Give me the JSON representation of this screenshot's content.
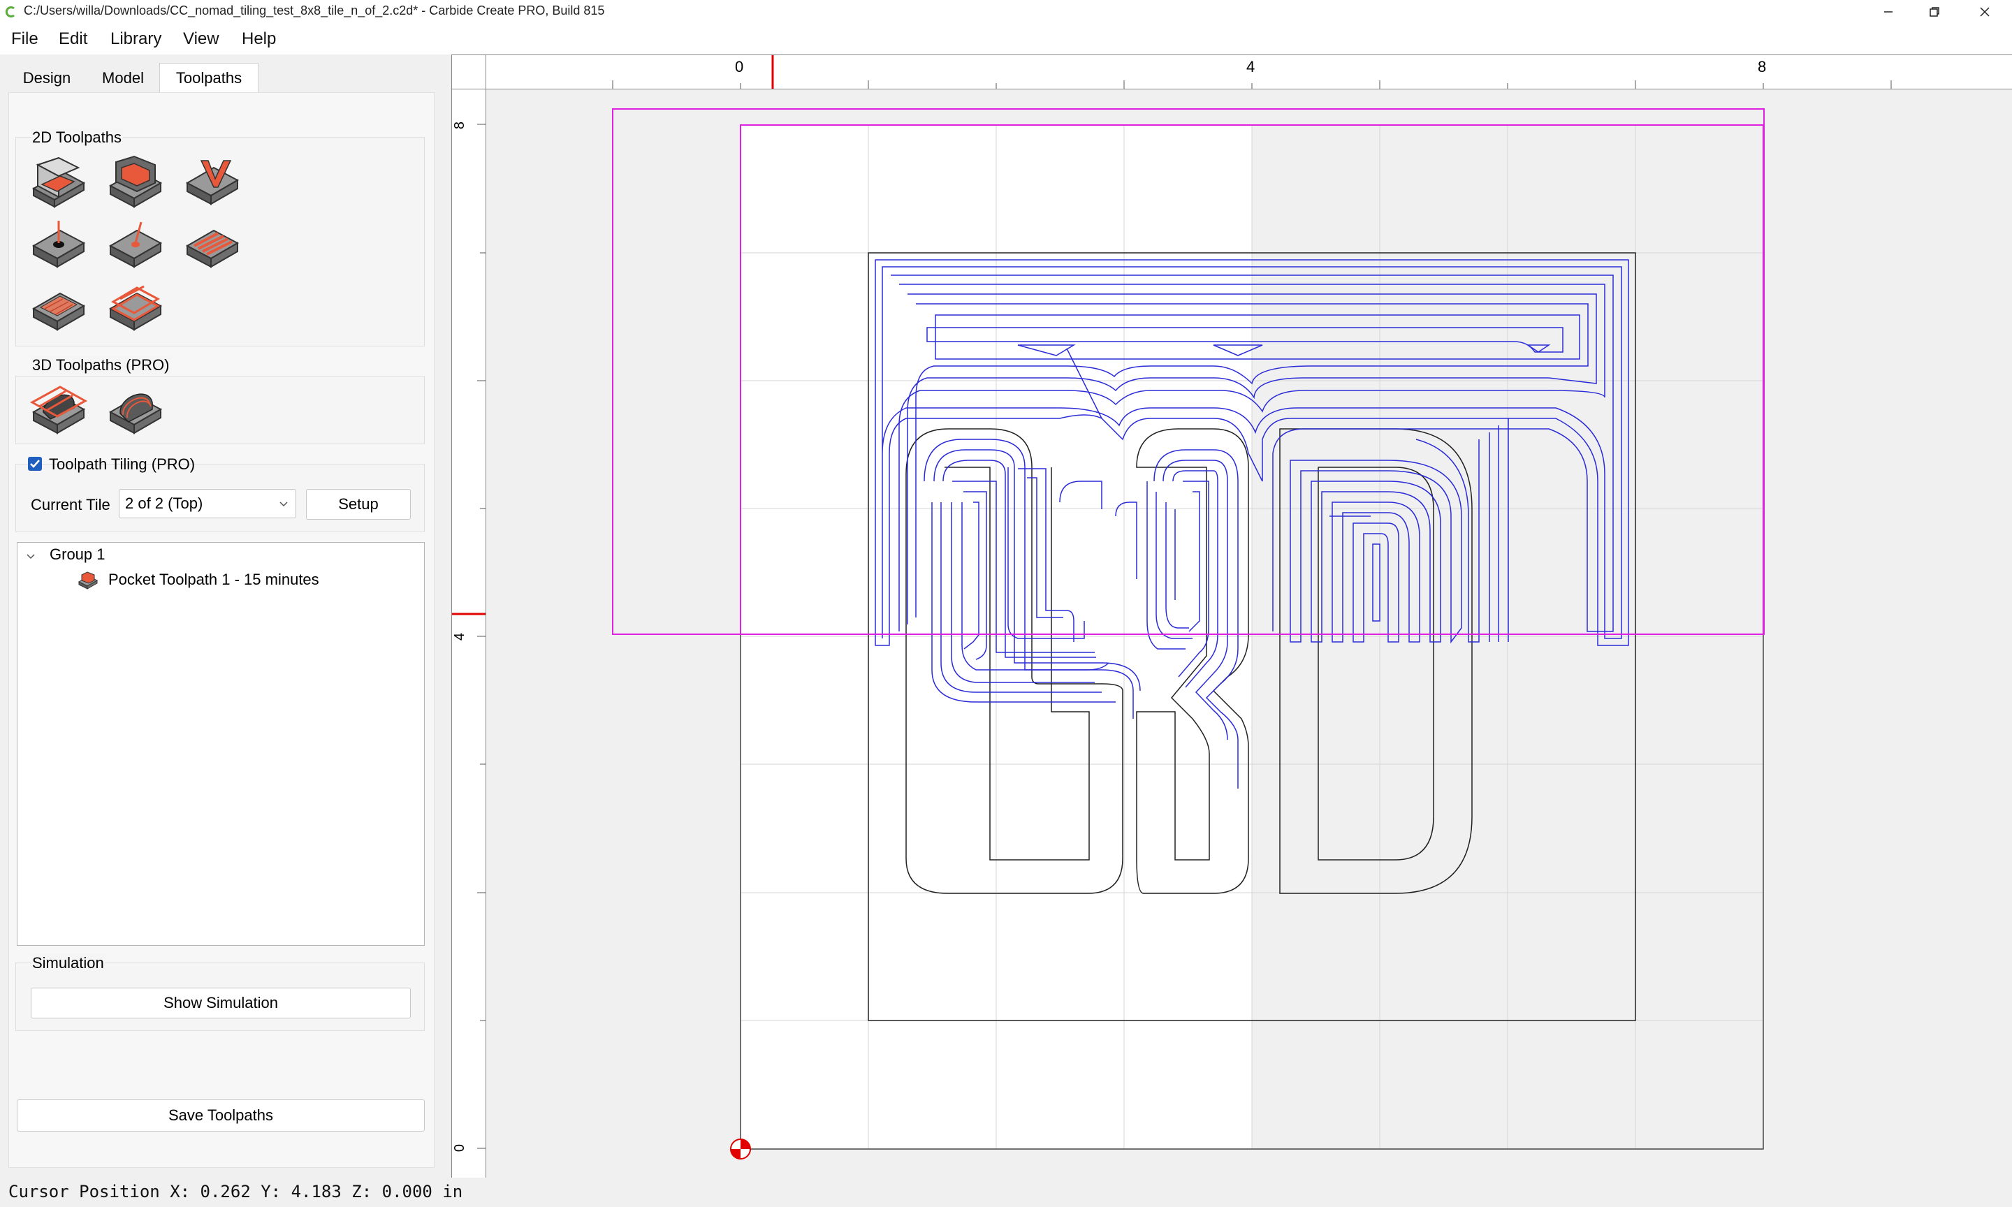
{
  "window": {
    "title": "C:/Users/willa/Downloads/CC_nomad_tiling_test_8x8_tile_n_of_2.c2d* - Carbide Create PRO, Build 815",
    "controls": [
      "minimize-icon",
      "restore-icon",
      "close-icon"
    ]
  },
  "menu": [
    "File",
    "Edit",
    "Library",
    "View",
    "Help"
  ],
  "tabs": [
    "Design",
    "Model",
    "Toolpaths"
  ],
  "active_tab": "Toolpaths",
  "toolpaths_panel": {
    "section_2d": "2D Toolpaths",
    "tools_2d": [
      "contour-toolpath-icon",
      "pocket-toolpath-icon",
      "vcarve-toolpath-icon",
      "drill-toolpath-icon",
      "bore-toolpath-icon",
      "texture-toolpath-icon",
      "advanced-vcarve-icon",
      "rough-toolpath-icon"
    ],
    "section_3d": "3D Toolpaths (PRO)",
    "tools_3d": [
      "3d-rough-icon",
      "3d-finish-icon"
    ],
    "tiling_label": "Toolpath Tiling (PRO)",
    "tiling_enabled": true,
    "current_tile_label": "Current Tile",
    "current_tile_value": "2 of 2 (Top)",
    "setup_label": "Setup",
    "tree": {
      "group_label": "Group 1",
      "items": [
        "Pocket Toolpath 1 - 15 minutes"
      ]
    },
    "simulation_section": "Simulation",
    "show_simulation_label": "Show Simulation",
    "save_toolpaths_label": "Save Toolpaths"
  },
  "rulers": {
    "top_labels": [
      "0",
      "4",
      "8"
    ],
    "left_labels": [
      "8",
      "4",
      "0"
    ]
  },
  "colors": {
    "toolpath": "#2b2bd8",
    "tile_boundary": "#e020e0",
    "cursor_marker": "#e00000",
    "geometry": "#222222",
    "icon_accent": "#e8583a"
  },
  "status": {
    "cursor_position": "Cursor Position X: 0.262 Y: 4.183 Z: 0.000 in"
  }
}
